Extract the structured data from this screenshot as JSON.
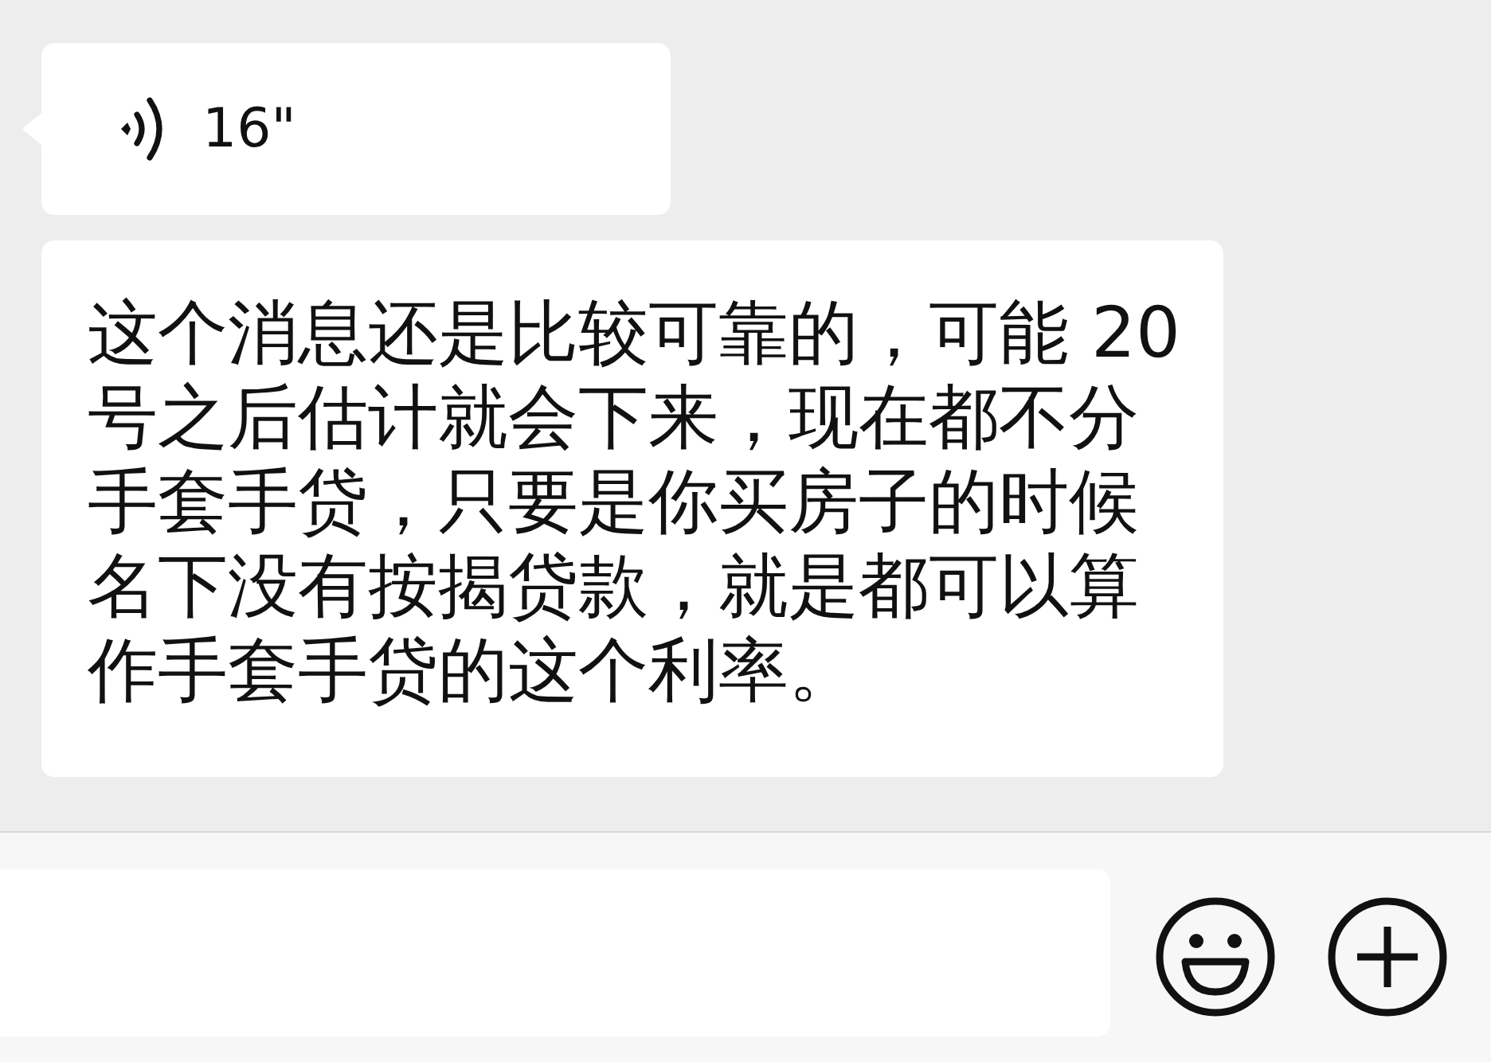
{
  "messages": [
    {
      "kind": "voice",
      "tail": true,
      "duration": "16\""
    },
    {
      "kind": "text",
      "tail": false,
      "text": "这个消息还是比较可靠的，可能 20号之后估计就会下来，现在都不分手套手贷，只要是你买房子的时候名下没有按揭贷款，就是都可以算作手套手贷的这个利率。"
    }
  ]
}
